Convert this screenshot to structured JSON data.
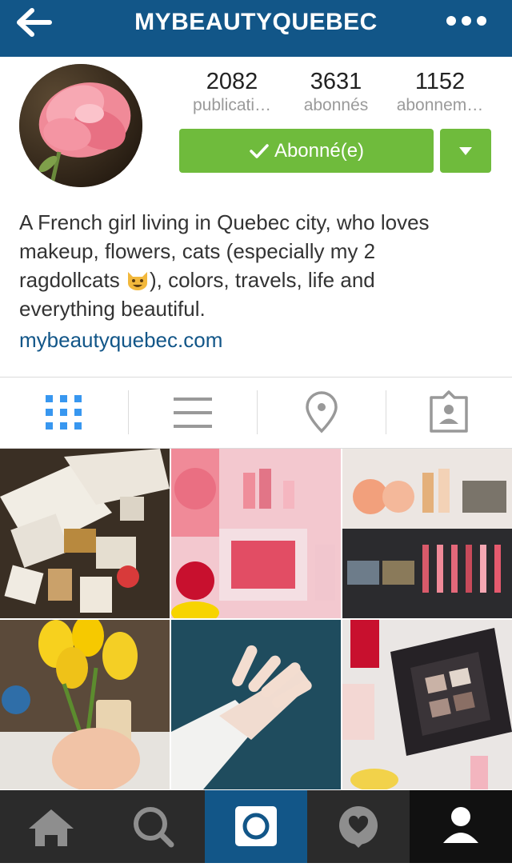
{
  "header": {
    "title": "MYBEAUTYQUEBEC",
    "back_icon": "back-arrow-icon",
    "more_icon": "more-dots-icon"
  },
  "profile": {
    "stats": [
      {
        "value": "2082",
        "label": "publicati…"
      },
      {
        "value": "3631",
        "label": "abonnés"
      },
      {
        "value": "1152",
        "label": "abonnem…"
      }
    ],
    "follow_button": "Abonné(e)",
    "bio_line1": "A French girl living in Quebec city, who loves",
    "bio_line2": "makeup, flowers, cats (especially my 2",
    "bio_line3_prefix": "ragdollcats ",
    "bio_line3_suffix": "), colors, travels, life and",
    "bio_line4": "everything beautiful.",
    "website": "mybeautyquebec.com"
  },
  "view_tabs": [
    {
      "icon": "grid-view-icon",
      "active": true
    },
    {
      "icon": "list-view-icon",
      "active": false
    },
    {
      "icon": "map-pin-icon",
      "active": false
    },
    {
      "icon": "tagged-photos-icon",
      "active": false
    }
  ],
  "bottom_nav": [
    {
      "icon": "home-icon"
    },
    {
      "icon": "search-icon"
    },
    {
      "icon": "camera-icon",
      "active": true
    },
    {
      "icon": "activity-heart-icon"
    },
    {
      "icon": "profile-icon"
    }
  ],
  "colors": {
    "brand_blue": "#125688",
    "follow_green": "#6fbb3c",
    "active_tab_blue": "#3897f0"
  }
}
